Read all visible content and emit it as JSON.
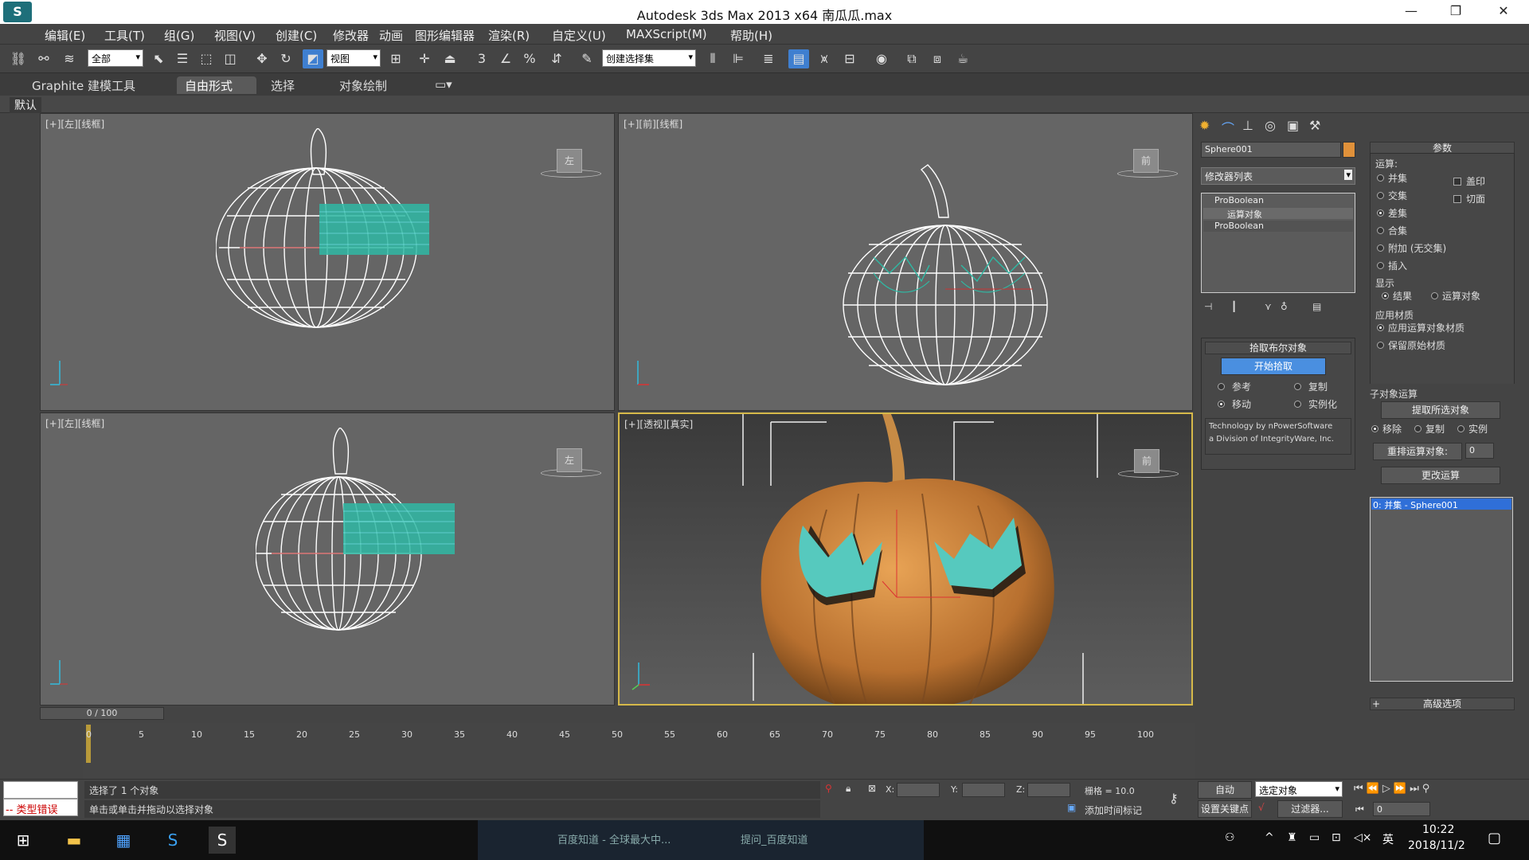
{
  "window": {
    "app_icon": "3dsmax-logo-icon",
    "title": "Autodesk 3ds Max  2013 x64     南瓜瓜.max",
    "minimize_icon": "—",
    "restore_icon": "❐",
    "close_icon": "✕"
  },
  "menu": [
    "编辑(E)",
    "工具(T)",
    "组(G)",
    "视图(V)",
    "创建(C)",
    "修改器",
    "动画",
    "图形编辑器",
    "渲染(R)",
    "自定义(U)",
    "MAXScript(M)",
    "帮助(H)"
  ],
  "toolbar": {
    "selection_filter": "全部",
    "ref_coord": "视图",
    "named_selection": "创建选择集",
    "snap_label": "3",
    "angle_snap_label": "",
    "percent_snap_label": "%"
  },
  "ribbon": {
    "tabs": [
      "Graphite 建模工具",
      "自由形式",
      "选择",
      "对象绘制"
    ],
    "active_tab": 1,
    "sub_label": "默认"
  },
  "viewports": [
    {
      "label": "[+][左][线框]",
      "cube_label": "左"
    },
    {
      "label": "[+][前][线框]",
      "cube_label": "前"
    },
    {
      "label": "[+][左][线框]",
      "cube_label": "左"
    },
    {
      "label": "[+][透视][真实]",
      "cube_label": "前"
    }
  ],
  "command_panel": {
    "object_name": "Sphere001",
    "object_color": "#e0913a",
    "modifier_list": "修改器列表",
    "stack": [
      "ProBoolean",
      "运算对象",
      "ProBoolean"
    ],
    "pick_section": {
      "title": "拾取布尔对象",
      "start_pick": "开始拾取",
      "opts": [
        "参考",
        "复制",
        "移动",
        "实例化"
      ],
      "selected_opt": 2,
      "credit_line1": "Technology by nPowerSoftware",
      "credit_line2": "a Division of IntegrityWare, Inc."
    },
    "params": {
      "title": "参数",
      "operation_label": "运算:",
      "operations": [
        "并集",
        "交集",
        "差集",
        "合集",
        "附加 (无交集)",
        "插入"
      ],
      "selected_operation": 2,
      "checks": [
        "盖印",
        "切面"
      ],
      "display_label": "显示",
      "display_opts": [
        "结果",
        "运算对象"
      ],
      "material_label": "应用材质",
      "material_opts": [
        "应用运算对象材质",
        "保留原始材质"
      ],
      "subobj_label": "子对象运算",
      "extract_btn": "提取所选对象",
      "extract_opts": [
        "移除",
        "复制",
        "实例"
      ],
      "reorder_btn": "重排运算对象:",
      "reorder_value": "0",
      "change_btn": "更改运算",
      "list_item": "0: 并集 - Sphere001",
      "advanced": "高级选项"
    }
  },
  "timeline": {
    "slider": "0 / 100",
    "ticks": [
      "0",
      "5",
      "10",
      "15",
      "20",
      "25",
      "30",
      "35",
      "40",
      "45",
      "50",
      "55",
      "60",
      "65",
      "70",
      "75",
      "80",
      "85",
      "90",
      "95",
      "100"
    ]
  },
  "status": {
    "selected_text": "选择了 1 个对象",
    "hint_text": "单击或单击并拖动以选择对象",
    "error_text": "-- 类型错误",
    "x_label": "X:",
    "y_label": "Y:",
    "z_label": "Z:",
    "grid": "栅格 = 10.0",
    "auto_key": "自动",
    "set_key": "设置关键点",
    "key_mode": "选定对象",
    "filters": "过滤器...",
    "add_time_tag": "添加时间标记",
    "frame_value": "0"
  },
  "taskbar": {
    "tabs": [
      "百度知道 - 全球最大中...",
      "提问_百度知道"
    ],
    "ime": "英",
    "time": "10:22",
    "date": "2018/11/2"
  }
}
